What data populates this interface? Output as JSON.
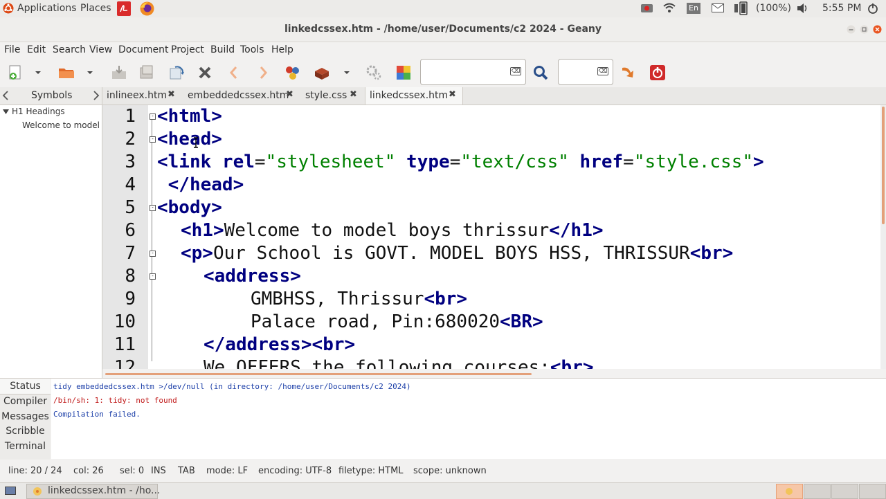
{
  "topbar": {
    "applications": "Applications",
    "places": "Places",
    "keyboard": "En",
    "battery": "(100%)",
    "clock": "5:55 PM"
  },
  "window": {
    "title": "linkedcssex.htm - /home/user/Documents/c2 2024 - Geany"
  },
  "menu": [
    "File",
    "Edit",
    "Search",
    "View",
    "Document",
    "Project",
    "Build",
    "Tools",
    "Help"
  ],
  "sidebar": {
    "tab_label": "Symbols",
    "group": "H1 Headings",
    "item": "Welcome to model b"
  },
  "tabs": [
    {
      "label": "inlineex.htm",
      "close": "✖"
    },
    {
      "label": "embeddedcssex.htm",
      "close": "✖"
    },
    {
      "label": "style.css",
      "close": "✖"
    },
    {
      "label": "linkedcssex.htm",
      "close": "✖"
    }
  ],
  "editor": {
    "lines": [
      "1",
      "2",
      "3",
      "4",
      "5",
      "6",
      "7",
      "8",
      "9",
      "10",
      "11",
      "12"
    ],
    "code": {
      "l1": [
        "<html>"
      ],
      "l2": [
        "<head>"
      ],
      "l3": [
        "<link",
        " rel",
        "=",
        "\"stylesheet\"",
        " type",
        "=",
        "\"text/css\"",
        " href",
        "=",
        "\"style.css\"",
        ">"
      ],
      "l4": [
        " </head>"
      ],
      "l5": [
        "<body>"
      ],
      "l6": [
        "<h1>",
        "Welcome to model boys thrissur",
        "</h1>"
      ],
      "l7": [
        "<p>",
        "Our School is GOVT. MODEL BOYS HSS, THRISSUR",
        "<br>"
      ],
      "l8": [
        "<address>"
      ],
      "l9": [
        "GMBHSS, Thrissur",
        "<br>"
      ],
      "l10": [
        "Palace road, Pin:680020",
        "<BR>"
      ],
      "l11": [
        "</address>",
        "<br>"
      ],
      "l12": [
        "We OFFERS the following courses:",
        "<br>"
      ]
    }
  },
  "messages": {
    "tabs": [
      "Status",
      "Compiler",
      "Messages",
      "Scribble",
      "Terminal"
    ],
    "lines": [
      "tidy embeddedcssex.htm >/dev/null (in directory: /home/user/Documents/c2 2024)",
      "/bin/sh: 1: tidy: not found",
      "Compilation failed."
    ],
    "line_colors": [
      "#1c3fa8",
      "#c01818",
      "#1c3fa8"
    ]
  },
  "status": {
    "line": "line: 20 / 24",
    "col": "col: 26",
    "sel": "sel: 0",
    "ins": "INS",
    "tab": "TAB",
    "mode": "mode: LF",
    "encoding": "encoding: UTF-8",
    "filetype": "filetype: HTML",
    "scope": "scope: unknown"
  },
  "taskbar": {
    "window_label": "linkedcssex.htm - /ho..."
  },
  "colors": {
    "tag": "#000080",
    "string": "#008000",
    "accent": "#e95420"
  }
}
